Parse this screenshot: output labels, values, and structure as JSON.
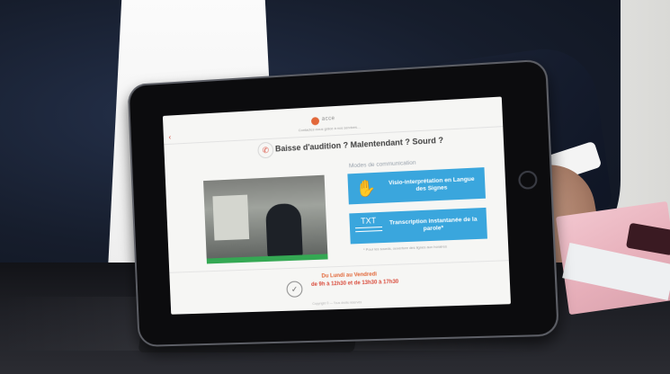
{
  "app": {
    "brand": "acce",
    "status": "",
    "subtitle": "Contactez-nous grâce à nos services…",
    "headline": "Baisse d'audition ? Malentendant ? Sourd ?",
    "modes_label": "Modes de communication",
    "services": [
      {
        "icon": "sign-language-icon",
        "label": "Visio-interprétation en Langue des Signes"
      },
      {
        "icon": "text-transcription-icon",
        "icon_text": "TXT",
        "label": "Transcription instantanée de la parole*"
      }
    ],
    "note": "* Pour les sourds, ouverture des lignes aux horaires",
    "hours": {
      "days": "Du Lundi au Vendredi",
      "times": "de 9h à 12h30 et de 13h30 à 17h30"
    },
    "footer": "Copyright © — Tous droits réservés",
    "video": {
      "time": ""
    }
  },
  "colors": {
    "accent_blue": "#3aa6dd",
    "accent_red": "#d94b3b",
    "accent_orange": "#e2683a",
    "video_bar": "#34a853"
  }
}
